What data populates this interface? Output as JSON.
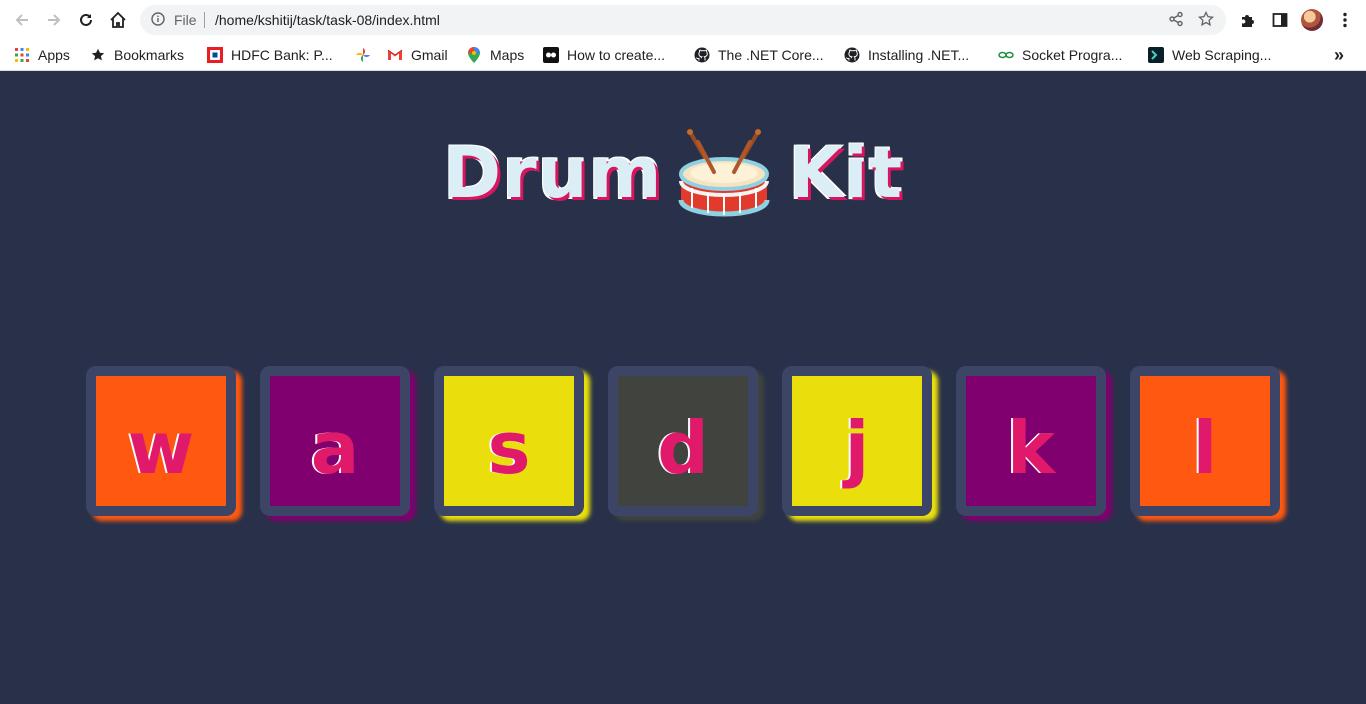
{
  "browser": {
    "protocol_label": "File",
    "url": "/home/kshitij/task/task-08/index.html",
    "more_label": "»",
    "bookmarks": [
      {
        "label": "Apps",
        "icon": "apps-grid-icon"
      },
      {
        "label": "Bookmarks",
        "icon": "star-icon"
      },
      {
        "label": "HDFC Bank: P...",
        "icon": "hdfc-icon"
      },
      {
        "label": "",
        "icon": "photos-pinwheel-icon"
      },
      {
        "label": "Gmail",
        "icon": "gmail-icon"
      },
      {
        "label": "Maps",
        "icon": "maps-pin-icon"
      },
      {
        "label": "How to create...",
        "icon": "video-icon"
      },
      {
        "label": "The .NET Core...",
        "icon": "github-icon"
      },
      {
        "label": "Installing .NET...",
        "icon": "github-icon"
      },
      {
        "label": "Socket Progra...",
        "icon": "link-icon"
      },
      {
        "label": "Web Scraping...",
        "icon": "terminal-icon"
      }
    ]
  },
  "page": {
    "title_left": "Drum",
    "title_right": "Kit",
    "title_icon": "drum-icon",
    "keys": [
      {
        "letter": "w",
        "color": "#ff5811"
      },
      {
        "letter": "a",
        "color": "#80006f"
      },
      {
        "letter": "s",
        "color": "#eadf0d"
      },
      {
        "letter": "d",
        "color": "#40433e"
      },
      {
        "letter": "j",
        "color": "#eadf0d"
      },
      {
        "letter": "k",
        "color": "#80006f"
      },
      {
        "letter": "l",
        "color": "#ff5811"
      }
    ],
    "background": "#283149",
    "letter_color": "#e0196b"
  }
}
